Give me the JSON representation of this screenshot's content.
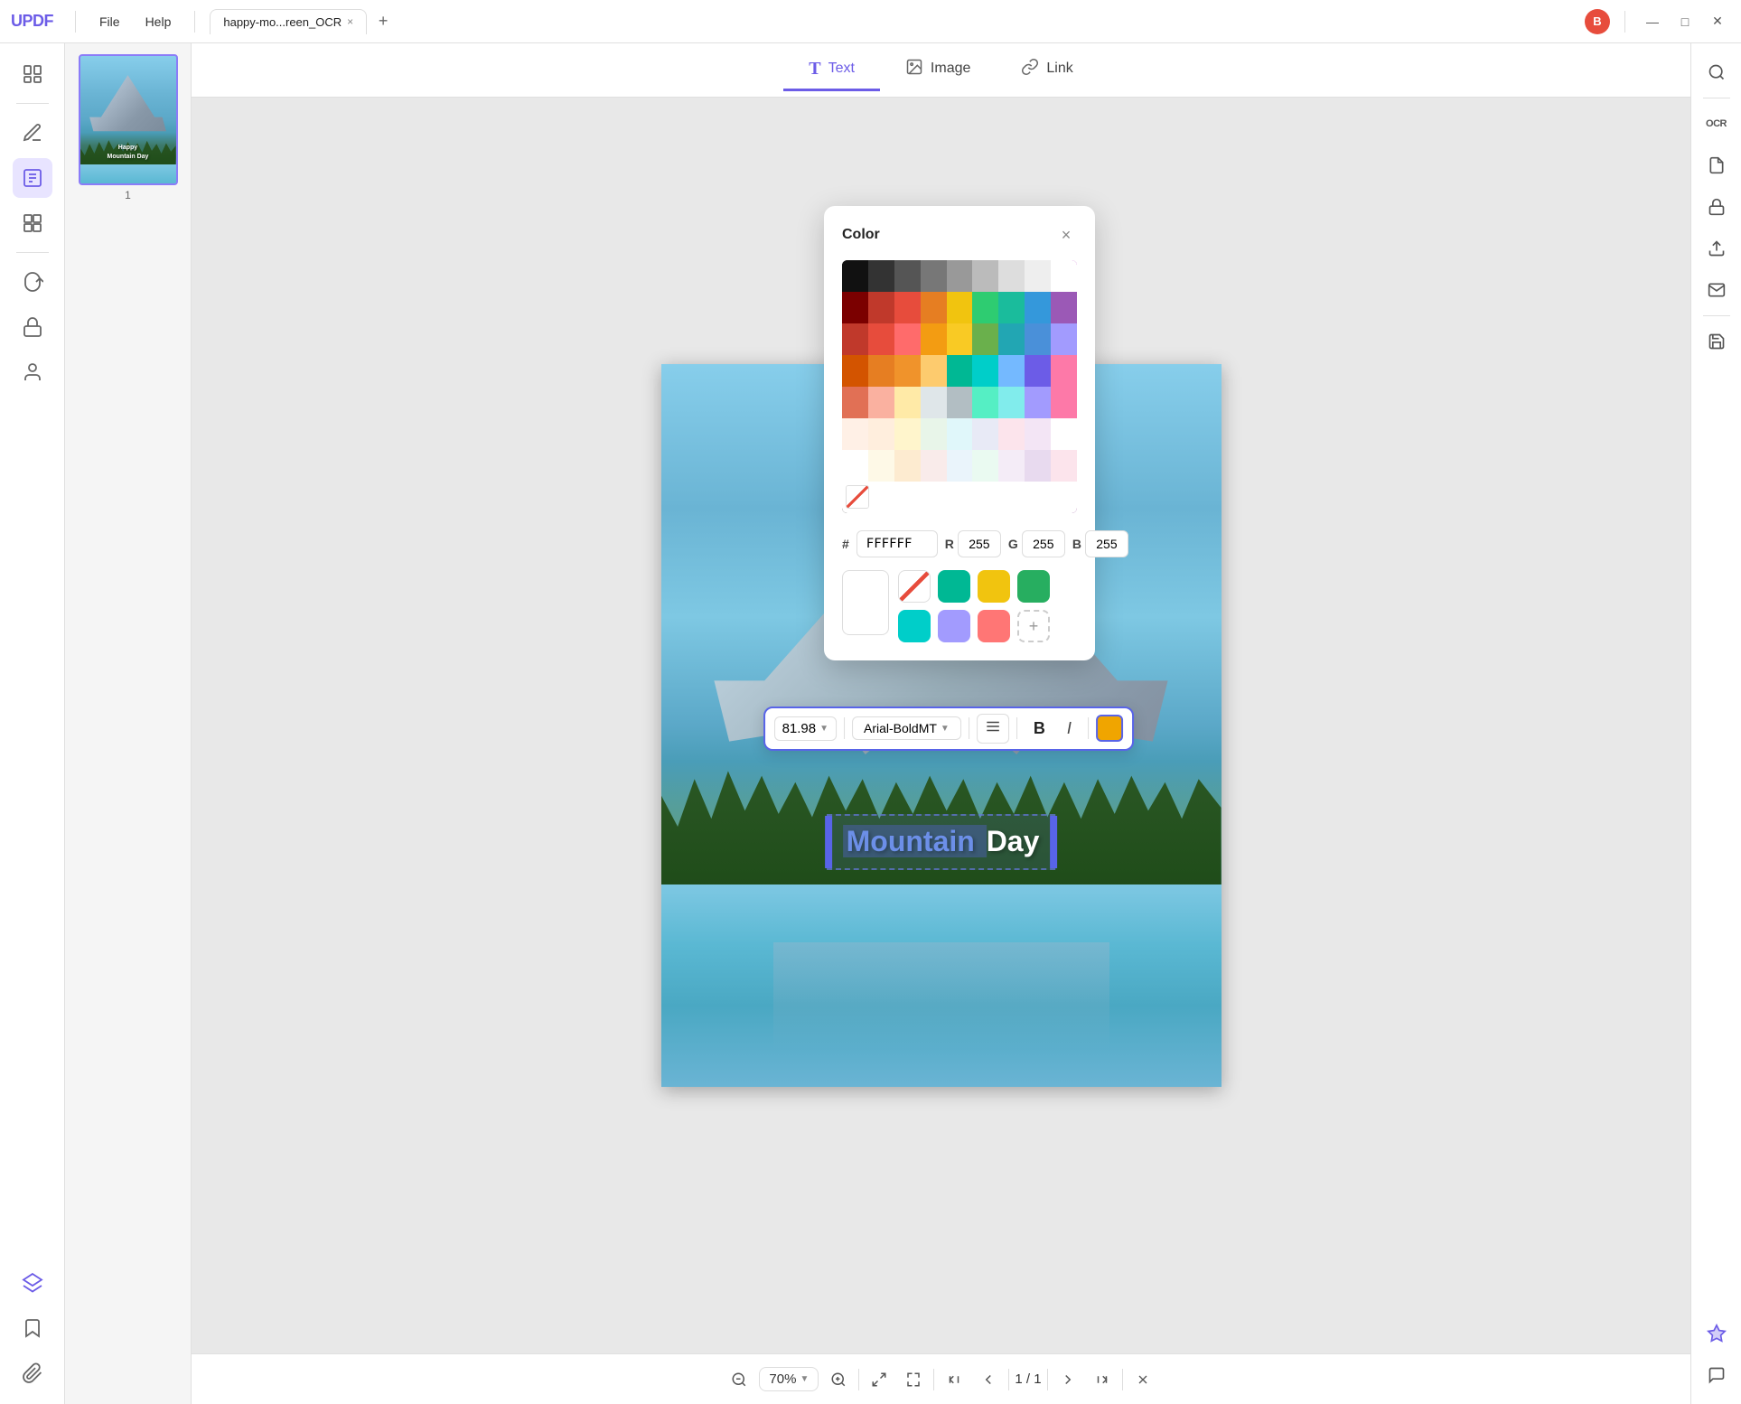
{
  "titlebar": {
    "logo": "UPDF",
    "menus": [
      "File",
      "Help"
    ],
    "tab_name": "happy-mo...reen_OCR",
    "tab_close": "×",
    "tab_add": "+",
    "avatar_label": "B",
    "minimize": "—",
    "maximize": "□",
    "close": "✕"
  },
  "left_sidebar": {
    "icons": [
      {
        "name": "read-mode-icon",
        "symbol": "📖",
        "active": false
      },
      {
        "name": "annotate-icon",
        "symbol": "✏️",
        "active": false
      },
      {
        "name": "edit-icon",
        "symbol": "📝",
        "active": true
      },
      {
        "name": "organize-icon",
        "symbol": "☰",
        "active": false
      },
      {
        "name": "convert-icon",
        "symbol": "↔",
        "active": false
      },
      {
        "name": "protect-icon",
        "symbol": "🔒",
        "active": false
      },
      {
        "name": "sign-icon",
        "symbol": "✍",
        "active": false
      }
    ],
    "bottom_icons": [
      {
        "name": "layers-icon",
        "symbol": "◆"
      },
      {
        "name": "bookmark-icon",
        "symbol": "🔖"
      },
      {
        "name": "attachment-icon",
        "symbol": "📎"
      }
    ]
  },
  "toolbar": {
    "tabs": [
      {
        "label": "Text",
        "icon": "T",
        "active": true
      },
      {
        "label": "Image",
        "icon": "🖼",
        "active": false
      },
      {
        "label": "Link",
        "icon": "🔗",
        "active": false
      }
    ]
  },
  "thumbnail": {
    "page_num": "1",
    "text_line1": "Happy",
    "text_line2": "Mountain Day"
  },
  "text_toolbar": {
    "font_size": "81.98",
    "font_name": "Arial-BoldMT",
    "align_icon": "≡",
    "bold_label": "B",
    "italic_label": "I",
    "color_label": "color"
  },
  "color_picker": {
    "title": "Color",
    "close": "×",
    "hex_label": "#",
    "hex_value": "FFFFFF",
    "r_label": "R",
    "r_value": "255",
    "g_label": "G",
    "g_value": "255",
    "b_label": "B",
    "b_value": "255",
    "presets": [
      {
        "color": "#e74c3c",
        "name": "red"
      },
      {
        "color": "#00b894",
        "name": "teal"
      },
      {
        "color": "#f1c40f",
        "name": "yellow"
      },
      {
        "color": "#00cec9",
        "name": "cyan"
      },
      {
        "color": "#6c5ce7",
        "name": "purple"
      },
      {
        "color": "#ff7675",
        "name": "pink"
      },
      {
        "color": "transparent",
        "name": "add"
      }
    ],
    "current_color": "#ffffff"
  },
  "bottom_bar": {
    "zoom_level": "70%",
    "page_current": "1",
    "page_total": "1",
    "zoom_out": "−",
    "zoom_in": "+",
    "fit_page": "⊡",
    "fit_width": "⊞",
    "first_page": "⏮",
    "prev_page": "◂",
    "next_page": "▸",
    "last_page": "⏭",
    "close_bar": "✕"
  },
  "right_sidebar": {
    "icons": [
      {
        "name": "search-icon",
        "symbol": "🔍"
      },
      {
        "name": "ocr-icon",
        "symbol": "OCR"
      },
      {
        "name": "organize-icon",
        "symbol": "📄"
      },
      {
        "name": "protect-icon",
        "symbol": "🔒"
      },
      {
        "name": "export-icon",
        "symbol": "↑"
      },
      {
        "name": "email-icon",
        "symbol": "✉"
      },
      {
        "name": "save-icon",
        "symbol": "💾"
      }
    ],
    "bottom_icons": [
      {
        "name": "rewards-icon",
        "symbol": "⭐"
      },
      {
        "name": "chat-icon",
        "symbol": "💬"
      }
    ]
  },
  "pdf": {
    "text_line1": "Mountain Day",
    "page_label": "1"
  }
}
